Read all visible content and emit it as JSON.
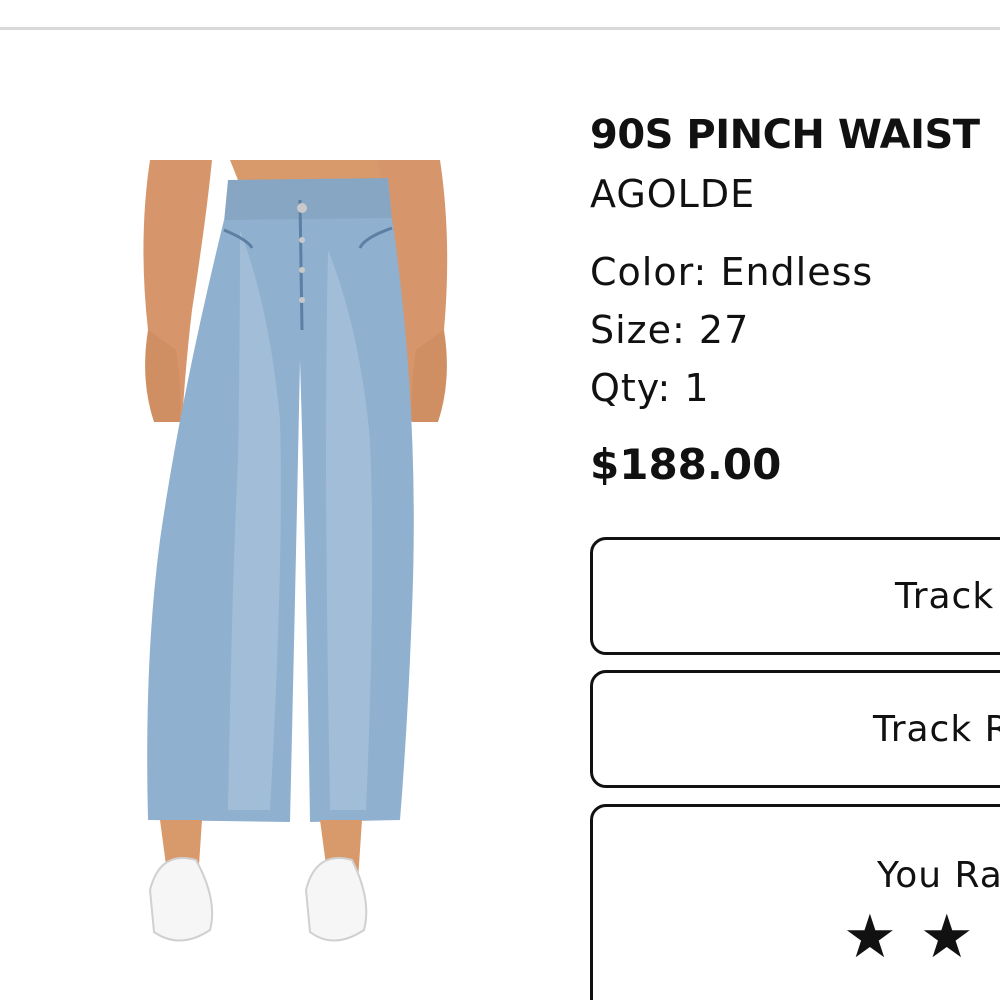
{
  "product": {
    "name": "90S PINCH WAIST",
    "brand": "AGOLDE",
    "color_label": "Color:",
    "color_value": "Endless",
    "size_label": "Size:",
    "size_value": "27",
    "qty_label": "Qty:",
    "qty_value": "1",
    "price": "$188.00",
    "image_icon": "jeans-product-photo"
  },
  "actions": {
    "track_label": "Track",
    "track_return_label": "Track R",
    "rate_label": "You Ra",
    "rating_stars": [
      "★",
      "★",
      "★"
    ]
  },
  "colors": {
    "denim": "#8fb0cf",
    "border": "#111111",
    "divider": "#d9d9d9"
  }
}
